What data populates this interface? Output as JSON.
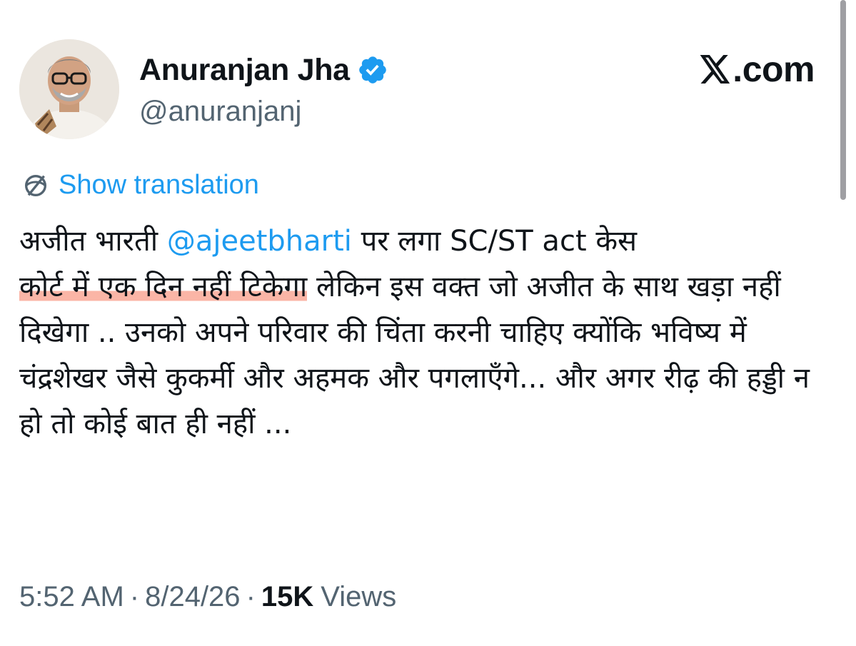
{
  "tweet": {
    "author": {
      "display_name": "Anuranjan Jha",
      "handle": "@anuranjanj",
      "verified": true
    },
    "site_label": "com",
    "translation_label": "Show translation",
    "body": {
      "line1_prefix": "अजीत भारती ",
      "mention": "@ajeetbharti",
      "line1_suffix": " पर लगा SC/ST act केस",
      "highlighted": "कोर्ट में एक दिन नहीं टिकेगा",
      "rest": " लेकिन इस वक्त जो अजीत के साथ खड़ा नहीं दिखेगा .. उनको अपने परिवार की चिंता करनी चाहिए क्योंकि भविष्य में चंद्रशेखर जैसे कुकर्मी और अहमक और पगलाएँगे... और अगर रीढ़ की हड्डी न हो तो कोई बात ही नहीं ..."
    },
    "meta": {
      "time": "5:52 AM",
      "date": "8/24/26",
      "views_count": "15K",
      "views_label": "Views",
      "separator": "·"
    }
  },
  "colors": {
    "link": "#1d9bf0",
    "muted": "#536471",
    "text": "#0f1419",
    "highlight": "#f7785c"
  },
  "icons": [
    "verified-badge-icon",
    "x-logo-icon",
    "translate-globe-icon"
  ]
}
